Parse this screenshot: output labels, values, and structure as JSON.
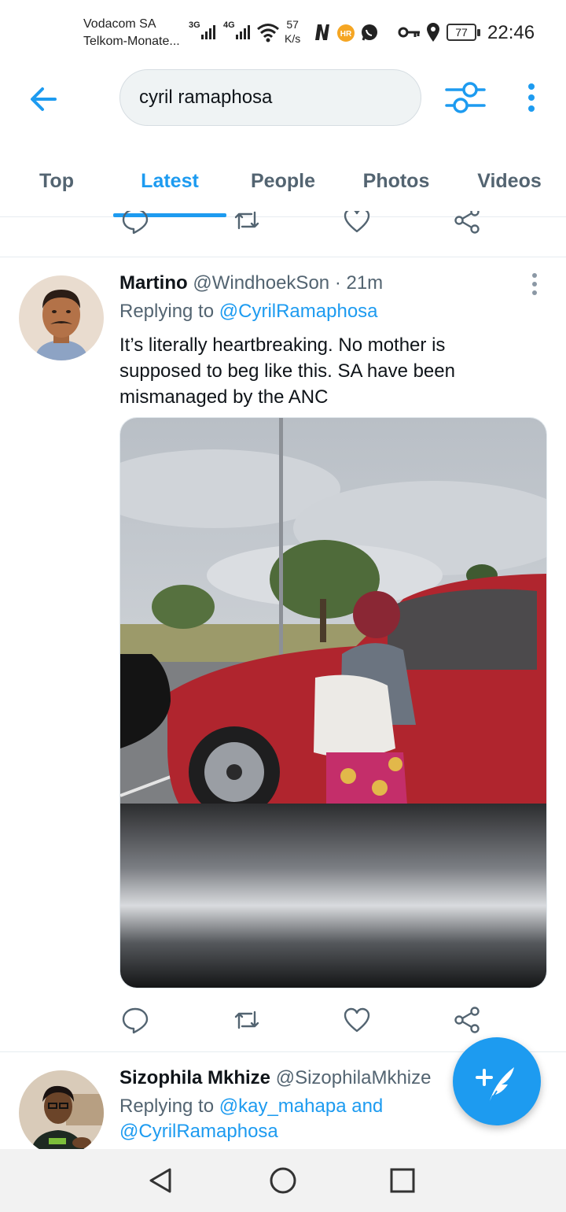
{
  "status_bar": {
    "carrier_1": "Vodacom SA",
    "carrier_2": "Telkom-Monate...",
    "net_1": "3G",
    "net_2": "4G",
    "speed_value": "57",
    "speed_unit": "K/s",
    "battery": "77",
    "time": "22:46",
    "icons": [
      "wifi-icon",
      "netflix-icon",
      "huawei-health-icon",
      "whatsapp-icon",
      "key-icon",
      "location-icon"
    ]
  },
  "search": {
    "query": "cyril ramaphosa"
  },
  "tabs": [
    {
      "label": "Top",
      "active": false
    },
    {
      "label": "Latest",
      "active": true
    },
    {
      "label": "People",
      "active": false
    },
    {
      "label": "Photos",
      "active": false
    },
    {
      "label": "Videos",
      "active": false
    }
  ],
  "tweets": [
    {
      "name": "Martino",
      "handle": "@WindhoekSon",
      "sep": "·",
      "time": "21m",
      "replying_label": "Replying to",
      "replying_to": "@CyrilRamaphosa",
      "text": "It’s literally heartbreaking. No mother is supposed to beg like this. SA have been mismanaged by the ANC"
    },
    {
      "name": "Sizophila Mkhize",
      "handle": "@SizophilaMkhize",
      "replying_label": "Replying to",
      "replying_to_1": "@kay_mahapa",
      "replying_and": "and",
      "replying_to_2": "@CyrilRamaphosa"
    }
  ],
  "colors": {
    "accent": "#1d9bf0",
    "muted": "#536471",
    "text": "#0f1419"
  }
}
